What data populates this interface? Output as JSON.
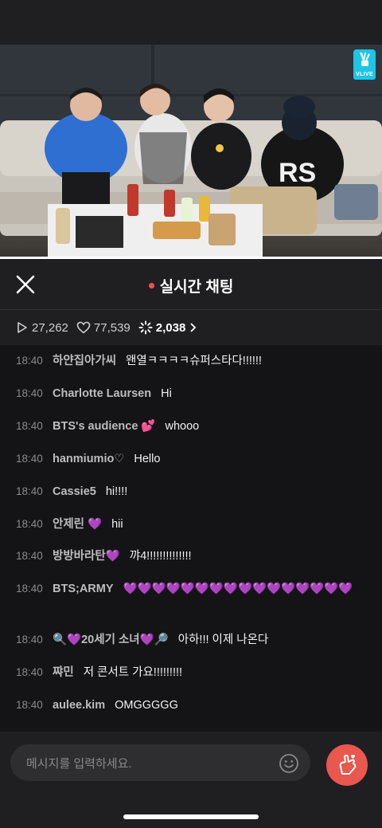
{
  "video": {
    "brand": "VLIVE",
    "jersey_text": "RS"
  },
  "chat_header": {
    "title": "실시간 채팅"
  },
  "stats": {
    "plays": "27,262",
    "likes": "77,539",
    "viewers": "2,038"
  },
  "messages": [
    {
      "time": "18:40",
      "user": "하얀집아가씨",
      "text": "왠열ㅋㅋㅋㅋ슈퍼스타다!!!!!!"
    },
    {
      "time": "18:40",
      "user": "Charlotte Laursen",
      "text": "Hi"
    },
    {
      "time": "18:40",
      "user": "BTS's audience 💕",
      "text": "whooo"
    },
    {
      "time": "18:40",
      "user": "hanmiumio♡",
      "text": "Hello"
    },
    {
      "time": "18:40",
      "user": "Cassie5",
      "text": "hi!!!!"
    },
    {
      "time": "18:40",
      "user": "안제린 💜",
      "text": "hii"
    },
    {
      "time": "18:40",
      "user": "방방바라탄💜",
      "text": "꺄4!!!!!!!!!!!!!!"
    },
    {
      "time": "18:40",
      "user": "BTS;ARMY",
      "text": "💜💜💜💜💜💜💜💜💜💜💜💜💜💜💜💜"
    },
    {
      "time": "18:40",
      "user": "🔍💜20세기 소녀💜🔎",
      "text": "아하!!! 이제 나온다"
    },
    {
      "time": "18:40",
      "user": "쨔민",
      "text": "저 콘서트 가요!!!!!!!!!"
    },
    {
      "time": "18:40",
      "user": "aulee.kim",
      "text": "OMGGGGG"
    }
  ],
  "input": {
    "placeholder": "메시지를 입력하세요."
  },
  "colors": {
    "accent_heart": "#e9574f",
    "live_dot": "#ff4c4c",
    "vlive": "#1ec5e5"
  }
}
